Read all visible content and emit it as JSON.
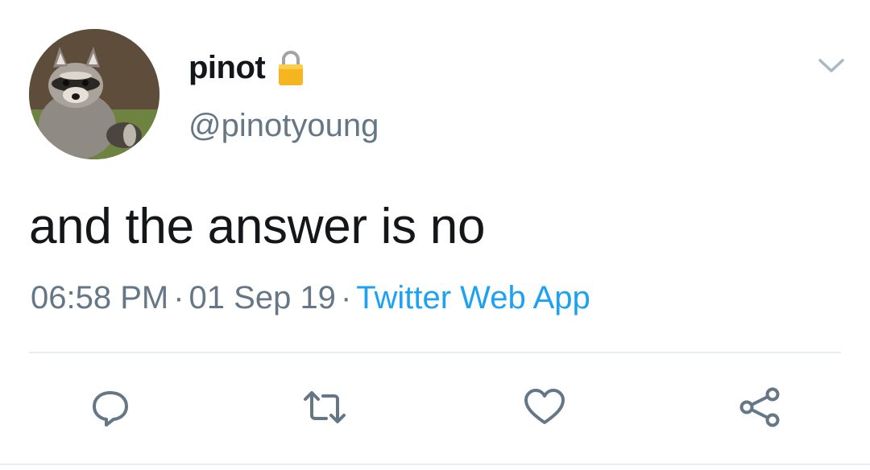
{
  "tweet": {
    "display_name": "pinot",
    "handle": "@pinotyoung",
    "text": "and the answer is no",
    "time": "06:58 PM",
    "date": "01 Sep 19",
    "separator": "·",
    "source": "Twitter Web App",
    "protected_icon": "lock-icon",
    "menu_icon": "chevron-down-icon"
  },
  "actions": [
    {
      "name": "reply",
      "icon": "reply-icon"
    },
    {
      "name": "retweet",
      "icon": "retweet-icon"
    },
    {
      "name": "like",
      "icon": "heart-icon"
    },
    {
      "name": "share",
      "icon": "share-icon"
    }
  ],
  "colors": {
    "text": "#14171a",
    "secondary": "#657786",
    "link": "#1da1f2",
    "icon": "#657786",
    "divider": "#e6ecf0",
    "lock": "#f5b520"
  }
}
